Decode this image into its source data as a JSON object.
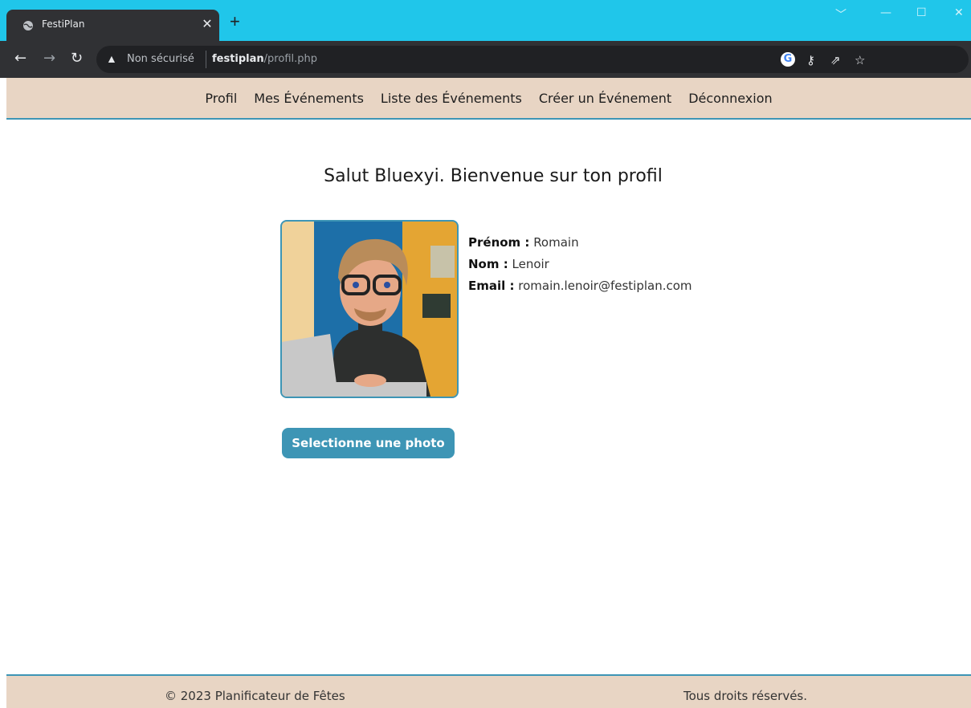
{
  "browser": {
    "tab_title": "FestiPlan",
    "security_label": "Non sécurisé",
    "url_domain": "festiplan",
    "url_path": "/profil.php"
  },
  "nav": {
    "items": [
      "Profil",
      "Mes Événements",
      "Liste des Événements",
      "Créer un Événement",
      "Déconnexion"
    ]
  },
  "profile": {
    "heading": "Salut Bluexyi. Bienvenue sur ton profil",
    "fields": [
      {
        "label": "Prénom :",
        "value": "Romain"
      },
      {
        "label": "Nom :",
        "value": "Lenoir"
      },
      {
        "label": "Email :",
        "value": "romain.lenoir@festiplan.com"
      }
    ],
    "upload_button": "Selectionne une photo"
  },
  "footer": {
    "copyright": "© 2023 Planificateur de Fêtes",
    "rights": "Tous droits réservés."
  },
  "colors": {
    "accent": "#3d95b5",
    "nav_bg": "#e8d5c4",
    "chrome_tab_strip": "#20c6ea"
  },
  "icons": [
    "globe-icon",
    "close-icon",
    "plus-icon",
    "back-arrow-icon",
    "forward-arrow-icon",
    "reload-icon",
    "warning-icon",
    "google-icon",
    "key-icon",
    "share-icon",
    "star-icon",
    "sidepanel-icon",
    "profile-icon",
    "menu-dots-icon"
  ]
}
